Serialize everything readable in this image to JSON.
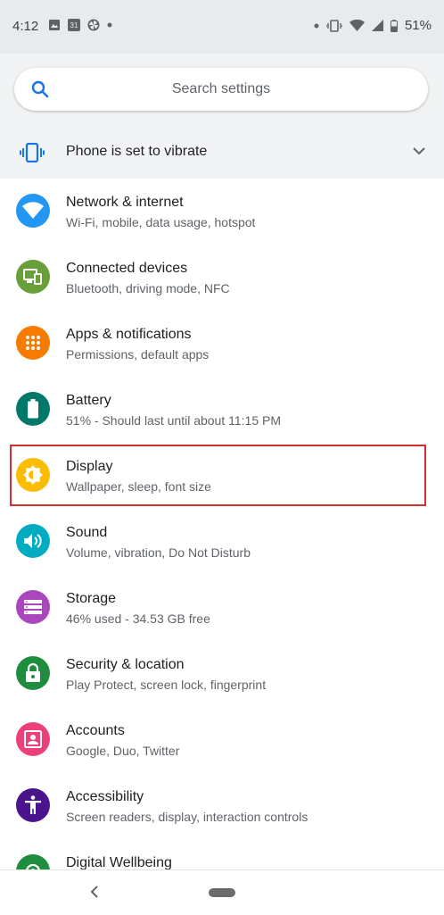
{
  "status_bar": {
    "time": "4:12",
    "calendar_day": "31",
    "battery": "51%"
  },
  "search": {
    "placeholder": "Search settings"
  },
  "vibrate": {
    "label": "Phone is set to vibrate"
  },
  "items": [
    {
      "title": "Network & internet",
      "subtitle": "Wi-Fi, mobile, data usage, hotspot",
      "color": "#2196f3",
      "icon": "wifi-icon"
    },
    {
      "title": "Connected devices",
      "subtitle": "Bluetooth, driving mode, NFC",
      "color": "#689f38",
      "icon": "devices-icon"
    },
    {
      "title": "Apps & notifications",
      "subtitle": "Permissions, default apps",
      "color": "#f57c00",
      "icon": "apps-grid-icon"
    },
    {
      "title": "Battery",
      "subtitle": "51% - Should last until about 11:15 PM",
      "color": "#00796b",
      "icon": "battery-icon"
    },
    {
      "title": "Display",
      "subtitle": "Wallpaper, sleep, font size",
      "color": "#fbbc04",
      "icon": "brightness-icon"
    },
    {
      "title": "Sound",
      "subtitle": "Volume, vibration, Do Not Disturb",
      "color": "#00acc1",
      "icon": "volume-icon"
    },
    {
      "title": "Storage",
      "subtitle": "46% used - 34.53 GB free",
      "color": "#ab47bc",
      "icon": "storage-icon"
    },
    {
      "title": "Security & location",
      "subtitle": "Play Protect, screen lock, fingerprint",
      "color": "#1e8e3e",
      "icon": "lock-icon"
    },
    {
      "title": "Accounts",
      "subtitle": "Google, Duo, Twitter",
      "color": "#ec407a",
      "icon": "account-icon"
    },
    {
      "title": "Accessibility",
      "subtitle": "Screen readers, display, interaction controls",
      "color": "#4a148c",
      "icon": "accessibility-icon"
    },
    {
      "title": "Digital Wellbeing",
      "subtitle": "",
      "color": "#1e8e3e",
      "icon": "wellbeing-icon"
    }
  ]
}
